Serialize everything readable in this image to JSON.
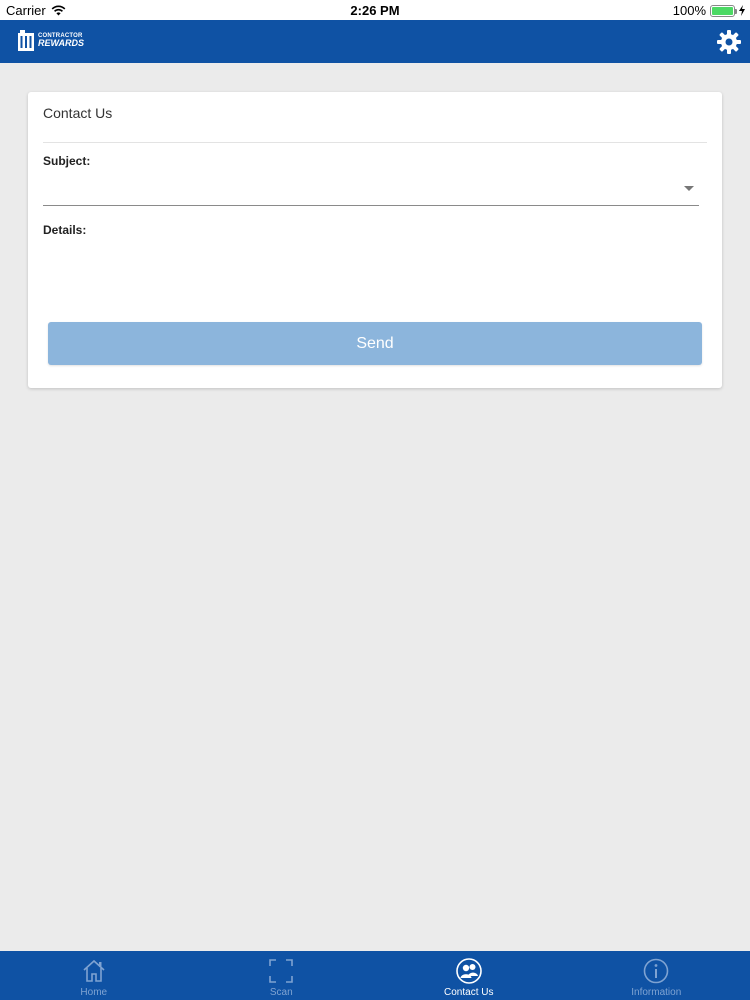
{
  "status_bar": {
    "carrier": "Carrier",
    "time": "2:26 PM",
    "battery": "100%"
  },
  "header": {
    "logo_line1": "CONTRACTOR",
    "logo_line2": "REWARDS",
    "brand_color": "#0f52a4",
    "settings_icon": "gear-icon"
  },
  "form": {
    "title": "Contact Us",
    "subject_label": "Subject:",
    "subject_value": "",
    "details_label": "Details:",
    "details_value": "",
    "send_label": "Send",
    "send_color": "#8cb5dc"
  },
  "tabs": [
    {
      "label": "Home",
      "icon": "home-icon",
      "active": false
    },
    {
      "label": "Scan",
      "icon": "scan-icon",
      "active": false
    },
    {
      "label": "Contact Us",
      "icon": "contact-icon",
      "active": true
    },
    {
      "label": "Information",
      "icon": "info-icon",
      "active": false
    }
  ]
}
